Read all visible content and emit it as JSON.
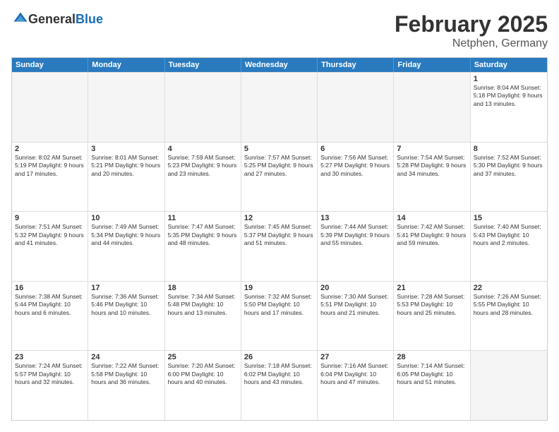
{
  "header": {
    "logo_general": "General",
    "logo_blue": "Blue",
    "month": "February 2025",
    "location": "Netphen, Germany"
  },
  "days_of_week": [
    "Sunday",
    "Monday",
    "Tuesday",
    "Wednesday",
    "Thursday",
    "Friday",
    "Saturday"
  ],
  "weeks": [
    [
      {
        "day": "",
        "empty": true
      },
      {
        "day": "",
        "empty": true
      },
      {
        "day": "",
        "empty": true
      },
      {
        "day": "",
        "empty": true
      },
      {
        "day": "",
        "empty": true
      },
      {
        "day": "",
        "empty": true
      },
      {
        "day": "1",
        "info": "Sunrise: 8:04 AM\nSunset: 5:18 PM\nDaylight: 9 hours and 13 minutes."
      }
    ],
    [
      {
        "day": "2",
        "info": "Sunrise: 8:02 AM\nSunset: 5:19 PM\nDaylight: 9 hours and 17 minutes."
      },
      {
        "day": "3",
        "info": "Sunrise: 8:01 AM\nSunset: 5:21 PM\nDaylight: 9 hours and 20 minutes."
      },
      {
        "day": "4",
        "info": "Sunrise: 7:59 AM\nSunset: 5:23 PM\nDaylight: 9 hours and 23 minutes."
      },
      {
        "day": "5",
        "info": "Sunrise: 7:57 AM\nSunset: 5:25 PM\nDaylight: 9 hours and 27 minutes."
      },
      {
        "day": "6",
        "info": "Sunrise: 7:56 AM\nSunset: 5:27 PM\nDaylight: 9 hours and 30 minutes."
      },
      {
        "day": "7",
        "info": "Sunrise: 7:54 AM\nSunset: 5:28 PM\nDaylight: 9 hours and 34 minutes."
      },
      {
        "day": "8",
        "info": "Sunrise: 7:52 AM\nSunset: 5:30 PM\nDaylight: 9 hours and 37 minutes."
      }
    ],
    [
      {
        "day": "9",
        "info": "Sunrise: 7:51 AM\nSunset: 5:32 PM\nDaylight: 9 hours and 41 minutes."
      },
      {
        "day": "10",
        "info": "Sunrise: 7:49 AM\nSunset: 5:34 PM\nDaylight: 9 hours and 44 minutes."
      },
      {
        "day": "11",
        "info": "Sunrise: 7:47 AM\nSunset: 5:35 PM\nDaylight: 9 hours and 48 minutes."
      },
      {
        "day": "12",
        "info": "Sunrise: 7:45 AM\nSunset: 5:37 PM\nDaylight: 9 hours and 51 minutes."
      },
      {
        "day": "13",
        "info": "Sunrise: 7:44 AM\nSunset: 5:39 PM\nDaylight: 9 hours and 55 minutes."
      },
      {
        "day": "14",
        "info": "Sunrise: 7:42 AM\nSunset: 5:41 PM\nDaylight: 9 hours and 59 minutes."
      },
      {
        "day": "15",
        "info": "Sunrise: 7:40 AM\nSunset: 5:43 PM\nDaylight: 10 hours and 2 minutes."
      }
    ],
    [
      {
        "day": "16",
        "info": "Sunrise: 7:38 AM\nSunset: 5:44 PM\nDaylight: 10 hours and 6 minutes."
      },
      {
        "day": "17",
        "info": "Sunrise: 7:36 AM\nSunset: 5:46 PM\nDaylight: 10 hours and 10 minutes."
      },
      {
        "day": "18",
        "info": "Sunrise: 7:34 AM\nSunset: 5:48 PM\nDaylight: 10 hours and 13 minutes."
      },
      {
        "day": "19",
        "info": "Sunrise: 7:32 AM\nSunset: 5:50 PM\nDaylight: 10 hours and 17 minutes."
      },
      {
        "day": "20",
        "info": "Sunrise: 7:30 AM\nSunset: 5:51 PM\nDaylight: 10 hours and 21 minutes."
      },
      {
        "day": "21",
        "info": "Sunrise: 7:28 AM\nSunset: 5:53 PM\nDaylight: 10 hours and 25 minutes."
      },
      {
        "day": "22",
        "info": "Sunrise: 7:26 AM\nSunset: 5:55 PM\nDaylight: 10 hours and 28 minutes."
      }
    ],
    [
      {
        "day": "23",
        "info": "Sunrise: 7:24 AM\nSunset: 5:57 PM\nDaylight: 10 hours and 32 minutes."
      },
      {
        "day": "24",
        "info": "Sunrise: 7:22 AM\nSunset: 5:58 PM\nDaylight: 10 hours and 36 minutes."
      },
      {
        "day": "25",
        "info": "Sunrise: 7:20 AM\nSunset: 6:00 PM\nDaylight: 10 hours and 40 minutes."
      },
      {
        "day": "26",
        "info": "Sunrise: 7:18 AM\nSunset: 6:02 PM\nDaylight: 10 hours and 43 minutes."
      },
      {
        "day": "27",
        "info": "Sunrise: 7:16 AM\nSunset: 6:04 PM\nDaylight: 10 hours and 47 minutes."
      },
      {
        "day": "28",
        "info": "Sunrise: 7:14 AM\nSunset: 6:05 PM\nDaylight: 10 hours and 51 minutes."
      },
      {
        "day": "",
        "empty": true
      }
    ]
  ]
}
